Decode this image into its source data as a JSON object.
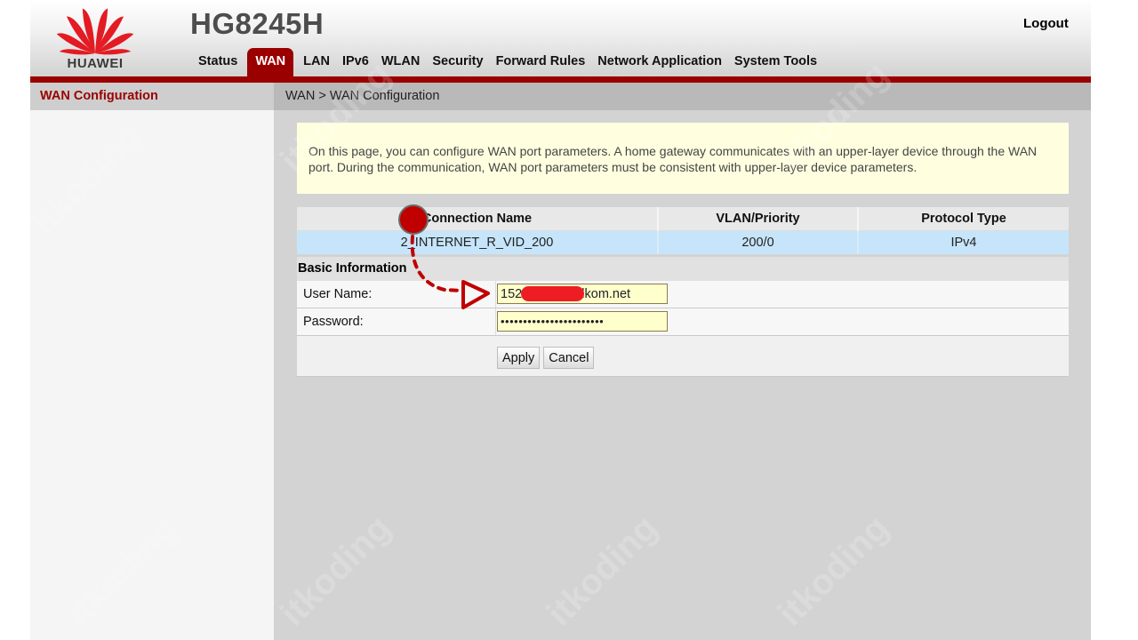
{
  "header": {
    "brand": "HUAWEI",
    "model": "HG8245H",
    "logout_label": "Logout",
    "brand_color": "#9b0000",
    "nav": [
      {
        "label": "Status",
        "active": false
      },
      {
        "label": "WAN",
        "active": true
      },
      {
        "label": "LAN",
        "active": false
      },
      {
        "label": "IPv6",
        "active": false
      },
      {
        "label": "WLAN",
        "active": false
      },
      {
        "label": "Security",
        "active": false
      },
      {
        "label": "Forward Rules",
        "active": false
      },
      {
        "label": "Network Application",
        "active": false
      },
      {
        "label": "System Tools",
        "active": false
      }
    ]
  },
  "sidebar": {
    "items": [
      {
        "label": "WAN Configuration",
        "active": true
      }
    ]
  },
  "content": {
    "breadcrumb": "WAN > WAN Configuration",
    "info_text": "On this page, you can configure WAN port parameters. A home gateway communicates with an upper-layer device through the WAN port. During the communication, WAN port parameters must be consistent with upper-layer device parameters.",
    "wan_table": {
      "columns": [
        "Connection Name",
        "VLAN/Priority",
        "Protocol Type"
      ],
      "rows": [
        [
          "2_INTERNET_R_VID_200",
          "200/0",
          "IPv4"
        ]
      ]
    },
    "basic_info": {
      "title": "Basic Information",
      "username_label": "User Name:",
      "username_value": "152          @telkom.net",
      "password_label": "Password:",
      "password_value": "•••••••••••••••••••••••"
    },
    "buttons": {
      "apply": "Apply",
      "cancel": "Cancel"
    }
  },
  "annotation": {
    "marker_color": "#c00000",
    "redaction_color": "#ee1d23"
  },
  "watermark": "itkoding"
}
